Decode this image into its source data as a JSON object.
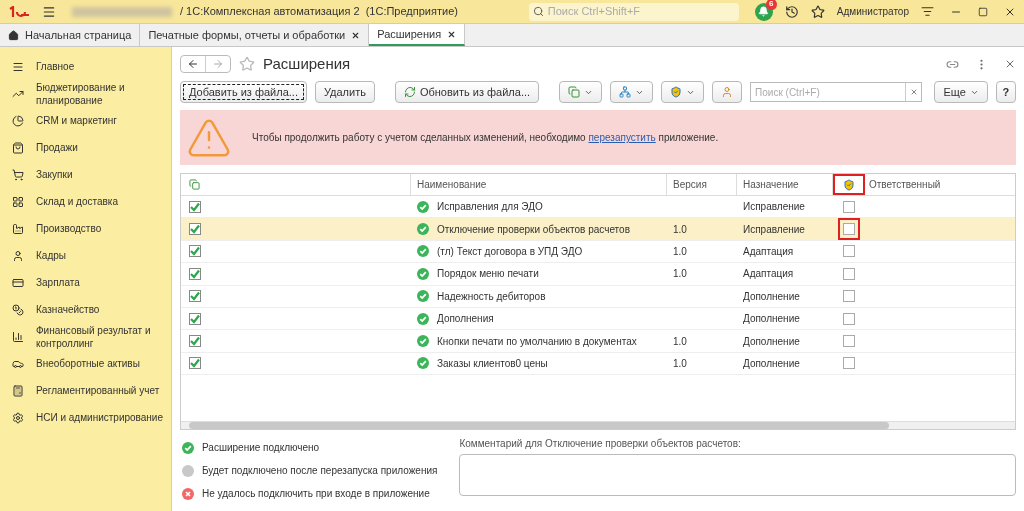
{
  "window": {
    "title": "/ 1С:Комплексная автоматизация 2  (1С:Предприятие)",
    "search_placeholder": "Поиск Ctrl+Shift+F",
    "notifications": "6",
    "user": "Администратор"
  },
  "tabs": [
    {
      "label": "Начальная страница",
      "selected": false,
      "kind": "home"
    },
    {
      "label": "Печатные формы, отчеты и обработки",
      "selected": false,
      "kind": "closable"
    },
    {
      "label": "Расширения",
      "selected": true,
      "kind": "closable"
    }
  ],
  "sidebar": {
    "items": [
      {
        "label": "Главное"
      },
      {
        "label": "Бюджетирование и планирование"
      },
      {
        "label": "CRM и маркетинг"
      },
      {
        "label": "Продажи"
      },
      {
        "label": "Закупки"
      },
      {
        "label": "Склад и доставка"
      },
      {
        "label": "Производство"
      },
      {
        "label": "Кадры"
      },
      {
        "label": "Зарплата"
      },
      {
        "label": "Казначейство"
      },
      {
        "label": "Финансовый результат и контроллинг"
      },
      {
        "label": "Внеоборотные активы"
      },
      {
        "label": "Регламентированный учет"
      },
      {
        "label": "НСИ и администрирование"
      }
    ]
  },
  "form": {
    "title": "Расширения",
    "favorite": false,
    "toolbar": [
      {
        "kind": "text",
        "label": "Добавить из файла...",
        "focused": true
      },
      {
        "kind": "text",
        "label": "Удалить",
        "focused": false
      },
      {
        "kind": "update",
        "label": "Обновить из файла..."
      },
      {
        "kind": "checks-menu"
      },
      {
        "kind": "network-menu"
      },
      {
        "kind": "shield-menu"
      },
      {
        "kind": "user"
      }
    ],
    "search_placeholder": "Поиск (Ctrl+F)",
    "more": "Еще",
    "help": "?",
    "warning": {
      "before": "Чтобы продолжить работу с учетом сделанных изменений, необходимо ",
      "link": "перезапустить",
      "after": " приложение."
    },
    "table": {
      "columns": [
        {
          "label": "Наименование"
        },
        {
          "label": "Версия"
        },
        {
          "label": "Назначение"
        },
        {
          "label": "Ответственный"
        }
      ],
      "safe_mode_header_marked": true,
      "rows": [
        {
          "active": true,
          "kind": "connected",
          "name": "Исправления для ЭДО",
          "purpose": "Исправление",
          "safe_mode": false,
          "selected": false,
          "marked": false
        },
        {
          "active": true,
          "kind": "connected",
          "name": "Отключение проверки объектов расчетов",
          "version": "1.0",
          "purpose": "Исправление",
          "safe_mode": false,
          "selected": true,
          "marked": true
        },
        {
          "active": true,
          "kind": "connected",
          "name": "(тл) Текст договора в УПД ЭДО",
          "version": "1.0",
          "purpose": "Адаптация",
          "safe_mode": false,
          "selected": false,
          "marked": false
        },
        {
          "active": true,
          "kind": "connected",
          "name": "Порядок меню печати",
          "version": "1.0",
          "purpose": "Адаптация",
          "safe_mode": false,
          "selected": false,
          "marked": false
        },
        {
          "active": true,
          "kind": "connected",
          "name": "Надежность дебиторов",
          "purpose": "Дополнение",
          "safe_mode": false,
          "selected": false,
          "marked": false
        },
        {
          "active": true,
          "kind": "connected",
          "name": "Дополнения",
          "purpose": "Дополнение",
          "safe_mode": false,
          "selected": false,
          "marked": false
        },
        {
          "active": true,
          "kind": "connected",
          "name": "Кнопки печати по умолчанию в документах",
          "version": "1.0",
          "purpose": "Дополнение",
          "safe_mode": false,
          "selected": false,
          "marked": false
        },
        {
          "active": true,
          "kind": "connected",
          "name": "Заказы клиентов0 цены",
          "version": "1.0",
          "purpose": "Дополнение",
          "safe_mode": false,
          "selected": false,
          "marked": false
        }
      ]
    },
    "legend": [
      {
        "kind": "connected",
        "label": "Расширение подключено"
      },
      {
        "kind": "pending",
        "label": "Будет подключено после перезапуска приложения"
      },
      {
        "kind": "failed",
        "label": "Не удалось подключить при входе в приложение"
      }
    ],
    "comment_label": "Комментарий для Отключение проверки объектов расчетов:"
  }
}
